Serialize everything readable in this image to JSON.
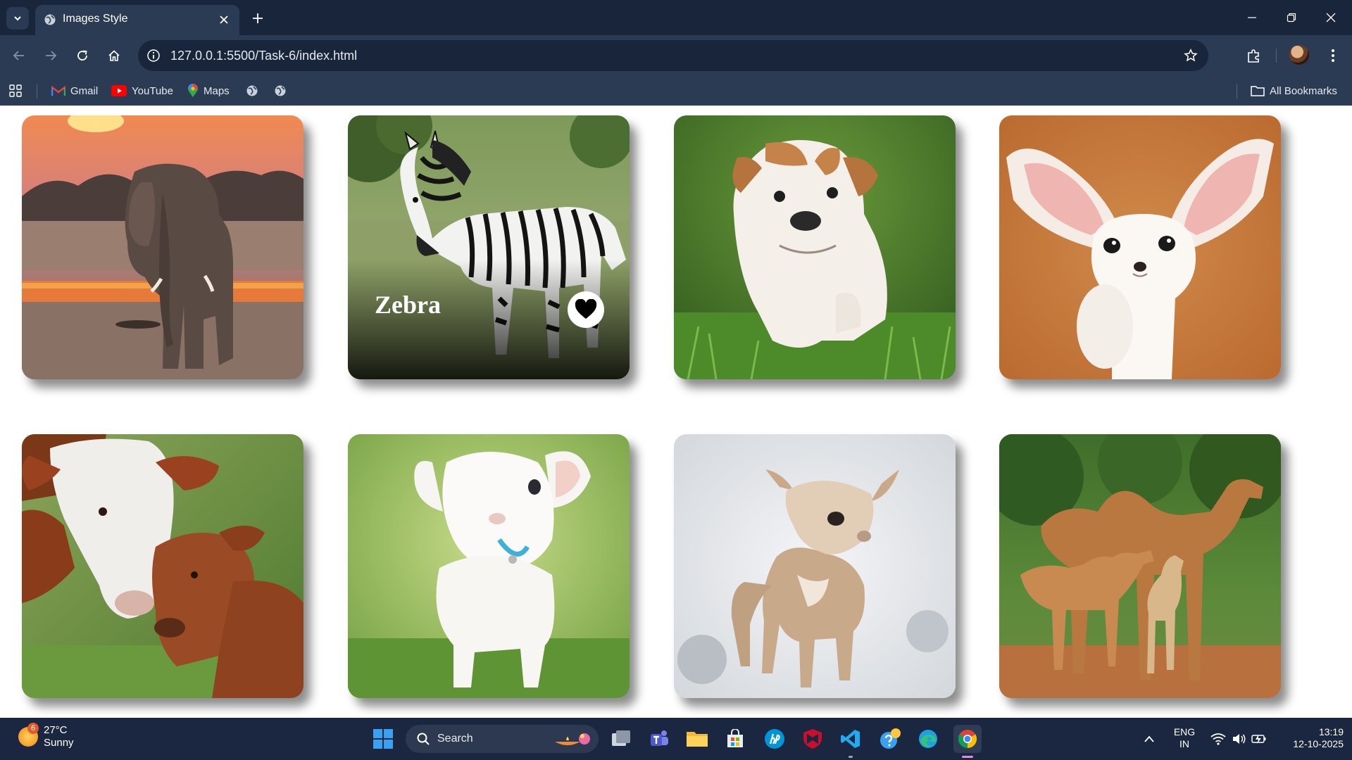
{
  "browser": {
    "tab_title": "Images Style",
    "url": "127.0.0.1:5500/Task-6/index.html",
    "bookmarks": [
      {
        "label": "Gmail",
        "icon": "gmail-icon"
      },
      {
        "label": "YouTube",
        "icon": "youtube-icon"
      },
      {
        "label": "Maps",
        "icon": "maps-icon"
      }
    ],
    "all_bookmarks_label": "All Bookmarks"
  },
  "gallery": {
    "cards": [
      {
        "animal": "elephant",
        "caption": ""
      },
      {
        "animal": "zebra",
        "caption": "Zebra",
        "favorite": true
      },
      {
        "animal": "bulldog puppy",
        "caption": ""
      },
      {
        "animal": "fennec fox",
        "caption": ""
      },
      {
        "animal": "cow and calf",
        "caption": ""
      },
      {
        "animal": "lamb",
        "caption": ""
      },
      {
        "animal": "baby goat",
        "caption": ""
      },
      {
        "animal": "camels",
        "caption": ""
      }
    ]
  },
  "taskbar": {
    "weather_badge": "6",
    "temperature": "27°C",
    "condition": "Sunny",
    "search_label": "Search",
    "language": "ENG",
    "region": "IN",
    "time": "13:19",
    "date": "12-10-2025"
  },
  "colors": {
    "chrome_dark": "#19253a",
    "chrome": "#2b3b53",
    "taskbar": "#1b2740"
  }
}
